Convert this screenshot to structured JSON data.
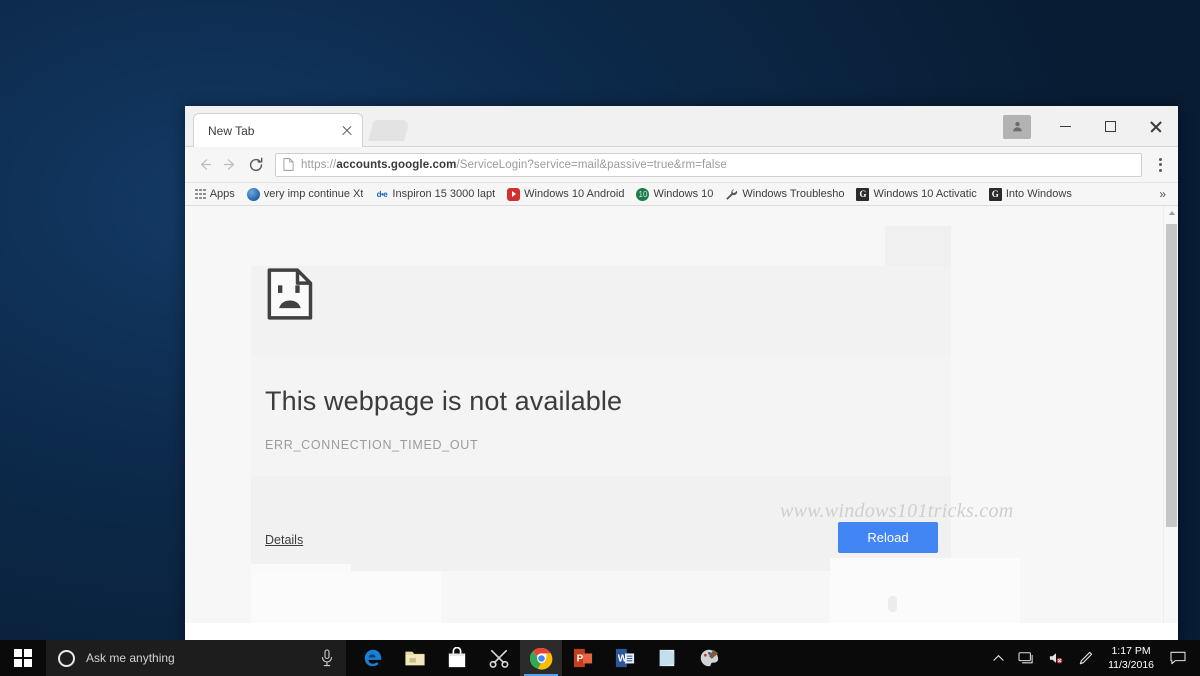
{
  "window": {
    "tab_title": "New Tab",
    "new_tab_button": "new-tab",
    "controls": {
      "profile": "user-profile",
      "minimize": "Minimize",
      "maximize": "Maximize",
      "close": "Close"
    }
  },
  "toolbar": {
    "back": "Back",
    "forward": "Forward",
    "reload": "Reload this page",
    "url_scheme": "https://",
    "url_host": "accounts.google.com",
    "url_path": "/ServiceLogin?service=mail&passive=true&rm=false",
    "url_full": "https://accounts.google.com/ServiceLogin?service=mail&passive=true&rm=false",
    "menu": "Customize and control Google Chrome"
  },
  "bookmarks": {
    "apps_label": "Apps",
    "overflow_label": "»",
    "items": [
      {
        "label": "very imp  continue Xt",
        "icon": "globe-favicon"
      },
      {
        "label": "Inspiron 15 3000 lapt",
        "icon": "dell-favicon"
      },
      {
        "label": "Windows 10 Android",
        "icon": "youtube-favicon"
      },
      {
        "label": "Windows 10",
        "icon": "green-circle-favicon"
      },
      {
        "label": "Windows Troublesho",
        "icon": "wrench-favicon"
      },
      {
        "label": "Windows 10 Activatic",
        "icon": "google-g-favicon"
      },
      {
        "label": "Into Windows",
        "icon": "google-g-favicon"
      }
    ]
  },
  "error_page": {
    "icon": "sad-page-icon",
    "title": "This webpage is not available",
    "code": "ERR_CONNECTION_TIMED_OUT",
    "details_link": "Details",
    "reload_button": "Reload",
    "watermark": "www.windows101tricks.com",
    "accent_color": "#4285f4"
  },
  "taskbar": {
    "start": "Start",
    "search_placeholder": "Ask me anything",
    "mic": "microphone-icon",
    "apps": [
      {
        "name": "microsoft-edge",
        "icon": "edge-icon",
        "active": false
      },
      {
        "name": "file-explorer",
        "icon": "folder-icon",
        "active": false
      },
      {
        "name": "microsoft-store",
        "icon": "store-icon",
        "active": false
      },
      {
        "name": "snipping-tool",
        "icon": "scissors-icon",
        "active": false
      },
      {
        "name": "google-chrome",
        "icon": "chrome-icon",
        "active": true
      },
      {
        "name": "powerpoint",
        "icon": "powerpoint-icon",
        "active": false
      },
      {
        "name": "word",
        "icon": "word-icon",
        "active": false
      },
      {
        "name": "onenote",
        "icon": "onenote-icon",
        "active": false
      },
      {
        "name": "paint",
        "icon": "paint-icon",
        "active": false
      }
    ],
    "tray": {
      "show_hidden": "show-hidden-icons",
      "network": "network-icon",
      "volume": "volume-muted-icon",
      "pen": "windows-ink-icon",
      "time": "1:17 PM",
      "date": "11/3/2016",
      "action_center": "action-center-icon"
    }
  }
}
